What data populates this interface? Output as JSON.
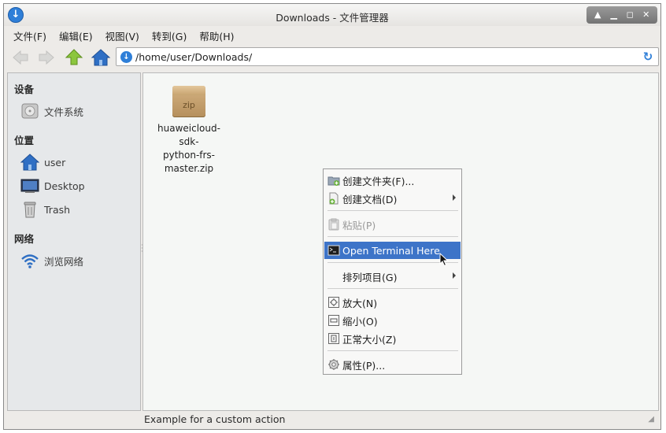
{
  "window": {
    "title": "Downloads - 文件管理器"
  },
  "menubar": [
    "文件(F)",
    "编辑(E)",
    "视图(V)",
    "转到(G)",
    "帮助(H)"
  ],
  "toolbar": {
    "location": "/home/user/Downloads/"
  },
  "sidebar": {
    "devices_heading": "设备",
    "devices": [
      {
        "label": "文件系统",
        "icon": "drive-icon"
      }
    ],
    "places_heading": "位置",
    "places": [
      {
        "label": "user",
        "icon": "home-icon"
      },
      {
        "label": "Desktop",
        "icon": "desktop-icon"
      },
      {
        "label": "Trash",
        "icon": "trash-icon"
      }
    ],
    "network_heading": "网络",
    "network": [
      {
        "label": "浏览网络",
        "icon": "network-icon"
      }
    ]
  },
  "files": [
    {
      "name_lines": [
        "huaweicloud-sdk-",
        "python-frs-",
        "master.zip"
      ],
      "icon_text": "zip",
      "icon": "zip-archive-icon"
    }
  ],
  "context_menu": {
    "items": [
      {
        "label": "创建文件夹(F)...",
        "icon": "new-folder-icon"
      },
      {
        "label": "创建文档(D)",
        "icon": "new-document-icon",
        "submenu": true
      },
      {
        "label": "粘贴(P)",
        "icon": "paste-icon",
        "disabled": true
      },
      {
        "label": "Open Terminal Here",
        "icon": "terminal-icon",
        "highlighted": true
      },
      {
        "label": "排列项目(G)",
        "submenu": true
      },
      {
        "label": "放大(N)",
        "icon": "zoom-in-icon"
      },
      {
        "label": "缩小(O)",
        "icon": "zoom-out-icon"
      },
      {
        "label": "正常大小(Z)",
        "icon": "zoom-normal-icon"
      },
      {
        "label": "属性(P)...",
        "icon": "properties-icon"
      }
    ]
  },
  "statusbar": {
    "text": "Example for a custom action"
  },
  "colors": {
    "accent": "#3d74c8",
    "sidebar_bg": "#e6e8ea",
    "content_bg": "#f5f7f5",
    "home_blue": "#2f6fc4",
    "up_green": "#8cc63e"
  }
}
